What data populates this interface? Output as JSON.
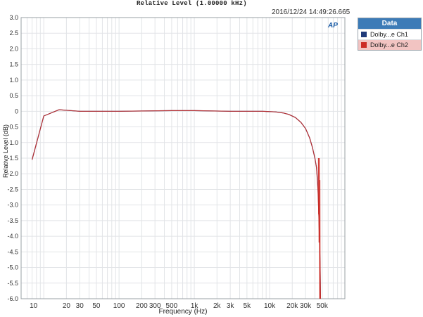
{
  "chart_data": {
    "type": "line",
    "title": "Relative Level (1.00000 kHz)",
    "timestamp": "2016/12/24 14:49:26.665",
    "xlabel": "Frequency (Hz)",
    "ylabel": "Relative Level (dB)",
    "xscale": "log",
    "xlim": [
      5,
      100000
    ],
    "ylim": [
      -6.0,
      3.0
    ],
    "x_ticks": [
      {
        "v": 10,
        "label": ""
      },
      {
        "v": 20,
        "label": "20"
      },
      {
        "v": 30,
        "label": "30"
      },
      {
        "v": 50,
        "label": "50"
      },
      {
        "v": 100,
        "label": "100"
      },
      {
        "v": 200,
        "label": "200"
      },
      {
        "v": 300,
        "label": "300"
      },
      {
        "v": 500,
        "label": "500"
      },
      {
        "v": 1000,
        "label": "1k"
      },
      {
        "v": 2000,
        "label": "2k"
      },
      {
        "v": 3000,
        "label": "3k"
      },
      {
        "v": 5000,
        "label": "5k"
      },
      {
        "v": 10000,
        "label": "10k"
      },
      {
        "v": 20000,
        "label": "20k"
      },
      {
        "v": 30000,
        "label": "30k"
      },
      {
        "v": 50000,
        "label": "50k"
      }
    ],
    "x_extra_labels": [
      {
        "v": 7,
        "label": "10"
      }
    ],
    "y_ticks": [
      "3.0",
      "2.5",
      "2.0",
      "1.5",
      "1.0",
      "0.5",
      "0",
      "-0.5",
      "-1.0",
      "-1.5",
      "-2.0",
      "-2.5",
      "-3.0",
      "-3.5",
      "-4.0",
      "-4.5",
      "-5.0",
      "-5.5",
      "-6.0"
    ],
    "grid": true,
    "legend_title": "Data",
    "legend_placement": "right",
    "series": [
      {
        "name": "Dolby...e Ch1",
        "color": "#1f3a7a",
        "x": [
          7,
          10,
          16,
          30,
          100,
          500,
          1000,
          3000,
          8000,
          12000,
          15000,
          18000,
          22000,
          26000,
          30000,
          34000,
          37000,
          40000,
          42000,
          43000,
          44000,
          45000,
          46000,
          47000,
          47500
        ],
        "y": [
          -1.55,
          -0.15,
          0.05,
          0.0,
          0.0,
          0.02,
          0.02,
          0.0,
          0.0,
          -0.02,
          -0.05,
          -0.1,
          -0.2,
          -0.35,
          -0.55,
          -0.85,
          -1.15,
          -1.5,
          -1.8,
          -2.1,
          -2.5,
          -3.2,
          -4.0,
          -5.0,
          -6.0
        ]
      },
      {
        "name": "Dolby...e Ch2",
        "color": "#cc2b25",
        "x": [
          7,
          10,
          16,
          30,
          100,
          500,
          1000,
          3000,
          8000,
          12000,
          15000,
          18000,
          22000,
          26000,
          30000,
          34000,
          37000,
          40000,
          42000,
          43000,
          44000,
          45000,
          46000,
          47000,
          47500
        ],
        "y": [
          -1.55,
          -0.15,
          0.05,
          0.0,
          0.0,
          0.02,
          0.02,
          0.0,
          0.0,
          -0.02,
          -0.05,
          -0.1,
          -0.2,
          -0.35,
          -0.55,
          -0.85,
          -1.15,
          -1.5,
          -1.8,
          -2.2,
          -2.6,
          -3.3,
          -4.1,
          -5.1,
          -6.0
        ]
      }
    ]
  },
  "legend": {
    "items": [
      {
        "label": "Dolby...e Ch1",
        "color": "#1f3a7a"
      },
      {
        "label": "Dolby...e Ch2",
        "color": "#cc2b25"
      }
    ]
  },
  "logo_text": "AP"
}
